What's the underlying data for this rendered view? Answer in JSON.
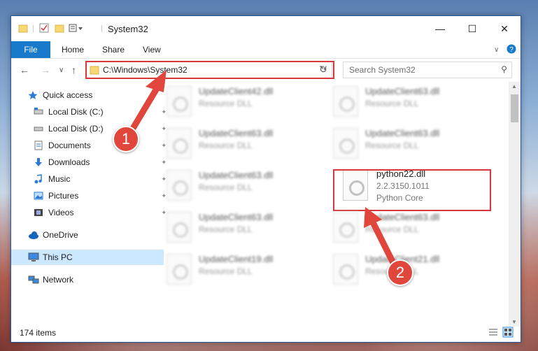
{
  "window": {
    "title": "System32"
  },
  "ribbon": {
    "tabs": [
      "File",
      "Home",
      "Share",
      "View"
    ]
  },
  "address": {
    "path": "C:\\Windows\\System32"
  },
  "search": {
    "placeholder": "Search System32"
  },
  "sidebar": {
    "items": [
      {
        "label": "Quick access"
      },
      {
        "label": "Local Disk (C:)"
      },
      {
        "label": "Local Disk (D:)"
      },
      {
        "label": "Documents"
      },
      {
        "label": "Downloads"
      },
      {
        "label": "Music"
      },
      {
        "label": "Pictures"
      },
      {
        "label": "Videos"
      },
      {
        "label": "OneDrive"
      },
      {
        "label": "This PC"
      },
      {
        "label": "Network"
      }
    ]
  },
  "files": [
    {
      "name": "UpdateClient42.dll",
      "sub": "Resource DLL"
    },
    {
      "name": "UpdateClient63.dll",
      "sub": "Resource DLL"
    },
    {
      "name": "UpdateClient63.dll",
      "sub": "Resource DLL"
    },
    {
      "name": "UpdateClient63.dll",
      "sub": "Resource DLL"
    },
    {
      "name": "UpdateClient63.dll",
      "sub": "Resource DLL"
    },
    {
      "name": "python22.dll",
      "version": "2.2.3150.1011",
      "sub": "Python Core"
    },
    {
      "name": "UpdateClient63.dll",
      "sub": "Resource DLL"
    },
    {
      "name": "UpdateClient63.dll",
      "sub": "Resource DLL"
    },
    {
      "name": "UpdateClient19.dll",
      "sub": "Resource DLL"
    },
    {
      "name": "UpdateClient21.dll",
      "sub": "Resource DLL"
    }
  ],
  "status": {
    "item_count": "174 items"
  },
  "callouts": [
    "1",
    "2"
  ],
  "colors": {
    "accent": "#1979ca",
    "highlight": "#d9383a"
  }
}
